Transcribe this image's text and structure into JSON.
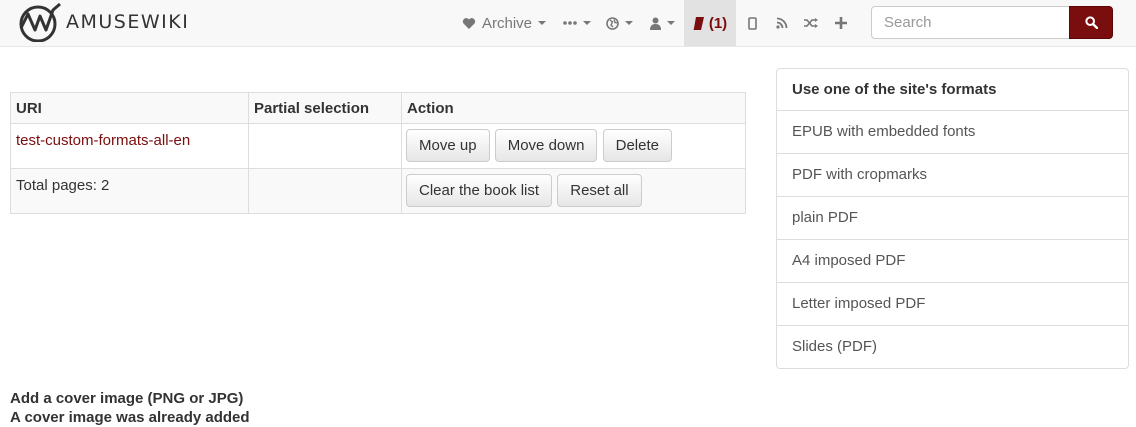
{
  "navbar": {
    "brand": "AMUSEWIKI",
    "archive_label": "Archive",
    "bookbuilder_count": "(1)",
    "search_placeholder": "Search"
  },
  "table": {
    "headers": [
      "URI",
      "Partial selection",
      "Action"
    ],
    "row": {
      "uri": "test-custom-formats-all-en",
      "partial": "",
      "buttons": {
        "move_up": "Move up",
        "move_down": "Move down",
        "delete": "Delete"
      }
    },
    "footer": {
      "total": "Total pages: 2",
      "buttons": {
        "clear": "Clear the book list",
        "reset": "Reset all"
      }
    }
  },
  "formats": {
    "heading": "Use one of the site's formats",
    "items": [
      "EPUB with embedded fonts",
      "PDF with cropmarks",
      "plain PDF",
      "A4 imposed PDF",
      "Letter imposed PDF",
      "Slides (PDF)"
    ]
  },
  "cover": {
    "title": "Add a cover image (PNG or JPG)",
    "note": "A cover image was already added"
  },
  "colors": {
    "accent": "#7a0d0d",
    "nav_text": "#777777"
  }
}
